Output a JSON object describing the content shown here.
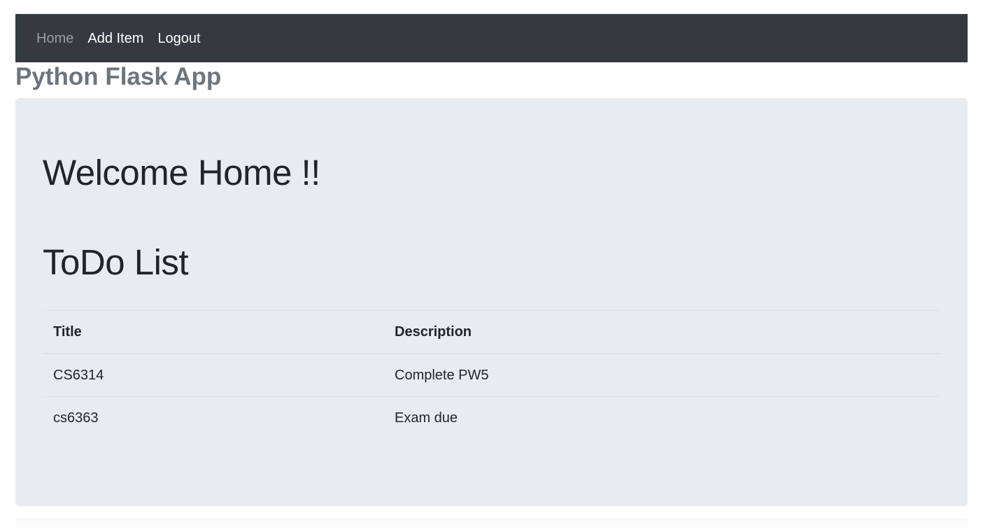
{
  "nav": {
    "items": [
      {
        "label": "Home",
        "active": true
      },
      {
        "label": "Add Item",
        "active": false
      },
      {
        "label": "Logout",
        "active": false
      }
    ]
  },
  "brand": {
    "title": "Python Flask App"
  },
  "main": {
    "welcome": "Welcome Home !!",
    "list_heading": "ToDo List",
    "table": {
      "headers": [
        "Title",
        "Description"
      ],
      "rows": [
        [
          "CS6314",
          "Complete PW5"
        ],
        [
          "cs6363",
          "Exam due"
        ]
      ]
    }
  },
  "colors": {
    "navbar_bg": "#343a40",
    "nav_active": "#9a9da1",
    "brand_text": "#6c757d",
    "jumbotron_bg": "#e9ecef"
  }
}
